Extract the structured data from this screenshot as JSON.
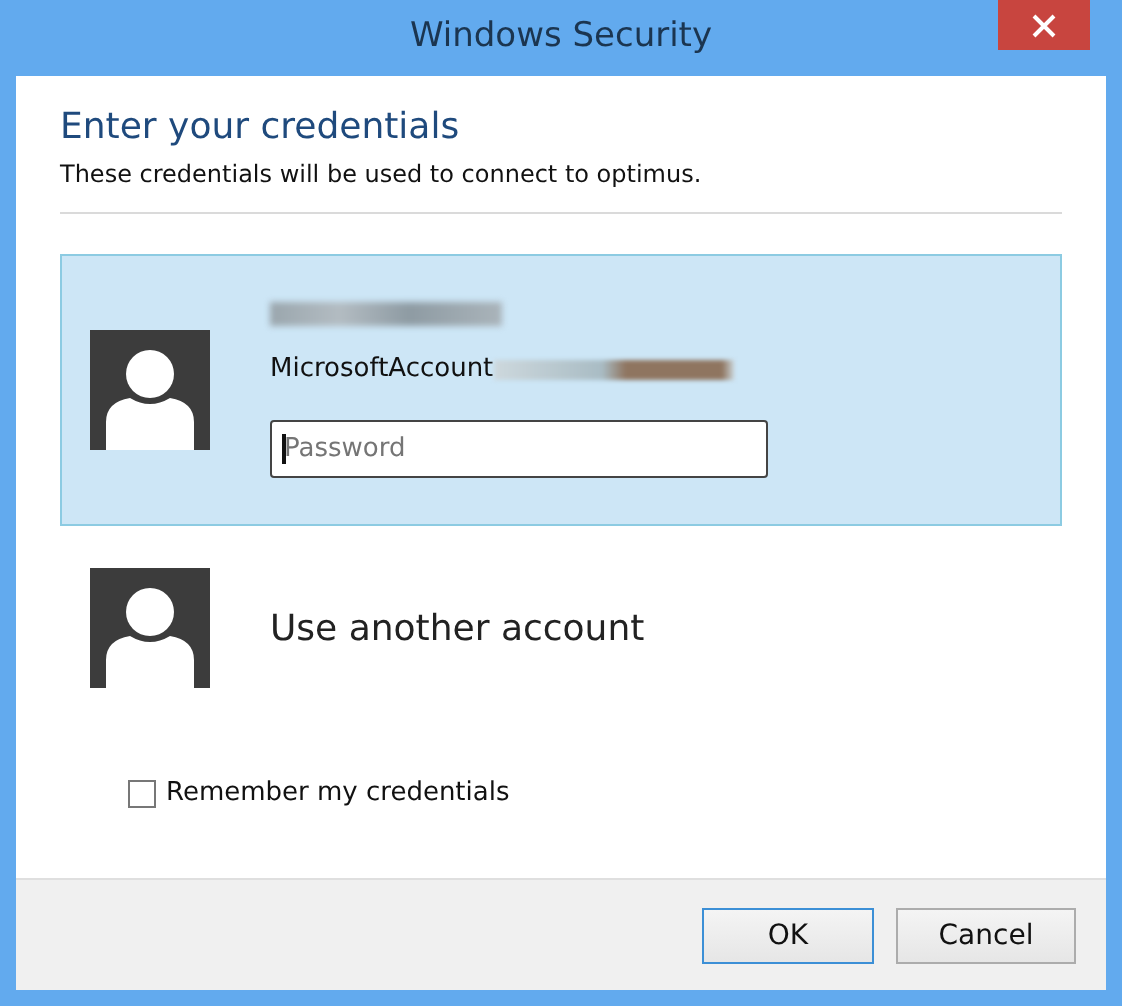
{
  "window": {
    "title": "Windows Security"
  },
  "heading": "Enter your credentials",
  "subtitle": "These credentials will be used to connect to optimus.",
  "accounts": [
    {
      "kind": "user",
      "selected": true,
      "name_redacted": true,
      "account": "MicrosoftAccount",
      "account_redacted": true,
      "password": {
        "placeholder": "Password",
        "focused": true
      }
    },
    {
      "kind": "other",
      "selected": false,
      "label": "Use another account"
    }
  ],
  "remember": {
    "label": "Remember my credentials",
    "checked": false
  },
  "buttons": [
    {
      "label": "OK",
      "default": true
    },
    {
      "label": "Cancel",
      "default": false
    }
  ]
}
